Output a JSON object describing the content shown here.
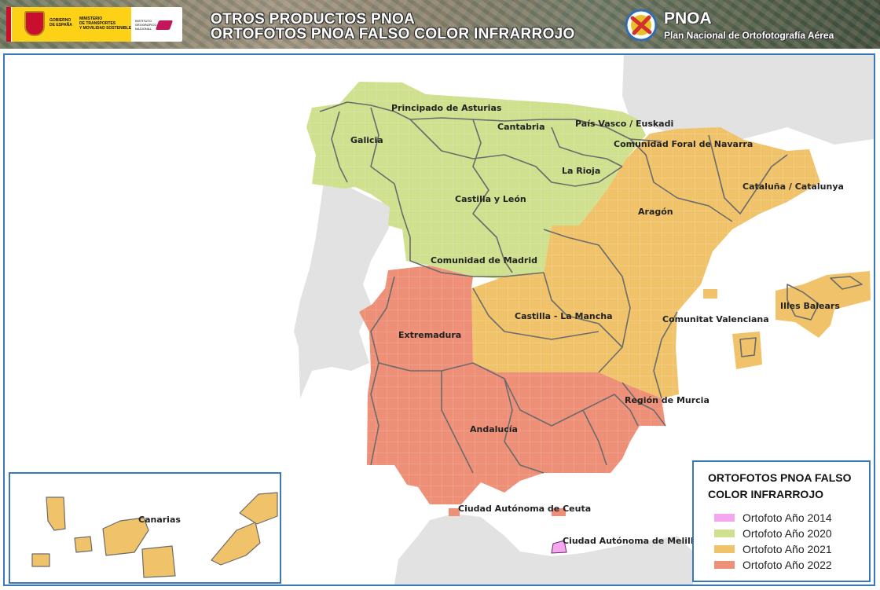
{
  "header": {
    "gov_line_1": "GOBIERNO\nDE ESPAÑA",
    "gov_line_2": "MINISTERIO\nDE TRANSPORTES\nY MOVILIDAD SOSTENIBLE",
    "inst_line": "INSTITUTO\nGEOGRÁFICO\nNACIONAL",
    "title_line_1": "OTROS PRODUCTOS PNOA",
    "title_line_2": "ORTOFOTOS PNOA FALSO COLOR INFRARROJO",
    "logo_name": "PNOA",
    "logo_subtitle": "Plan Nacional de Ortofotografía Aérea"
  },
  "colors": {
    "year_2014": "#f4a6f0",
    "year_2020": "#cfe08f",
    "year_2021": "#f0c36a",
    "year_2022": "#ee9078",
    "sea": "#ffffff",
    "land_other": "#e2e2e2",
    "border": "#6b6b6b",
    "frame": "#3a78b9"
  },
  "regions": {
    "asturias": "Principado de Asturias",
    "cantabria": "Cantabria",
    "pais_vasco": "País Vasco / Euskadi",
    "galicia": "Galicia",
    "navarra": "Comunidad Foral de Navarra",
    "la_rioja": "La Rioja",
    "cataluna": "Cataluña / Catalunya",
    "castilla_leon": "Castilla y León",
    "aragon": "Aragón",
    "madrid": "Comunidad de Madrid",
    "baleares": "Illes Balears",
    "castilla_mancha": "Castilla - La Mancha",
    "valenciana": "Comunitat Valenciana",
    "extremadura": "Extremadura",
    "murcia": "Región de Murcia",
    "andalucia": "Andalucía",
    "ceuta": "Ciudad Autónoma de Ceuta",
    "melilla": "Ciudad Autónoma de Melilla",
    "canarias": "Canarias"
  },
  "legend": {
    "title": "ORTOFOTOS PNOA FALSO COLOR INFRARROJO",
    "items": [
      {
        "label": "Ortofoto Año 2014",
        "color": "#f4a6f0"
      },
      {
        "label": "Ortofoto Año 2020",
        "color": "#cfe08f"
      },
      {
        "label": "Ortofoto Año 2021",
        "color": "#f0c36a"
      },
      {
        "label": "Ortofoto Año 2022",
        "color": "#ee9078"
      }
    ]
  }
}
